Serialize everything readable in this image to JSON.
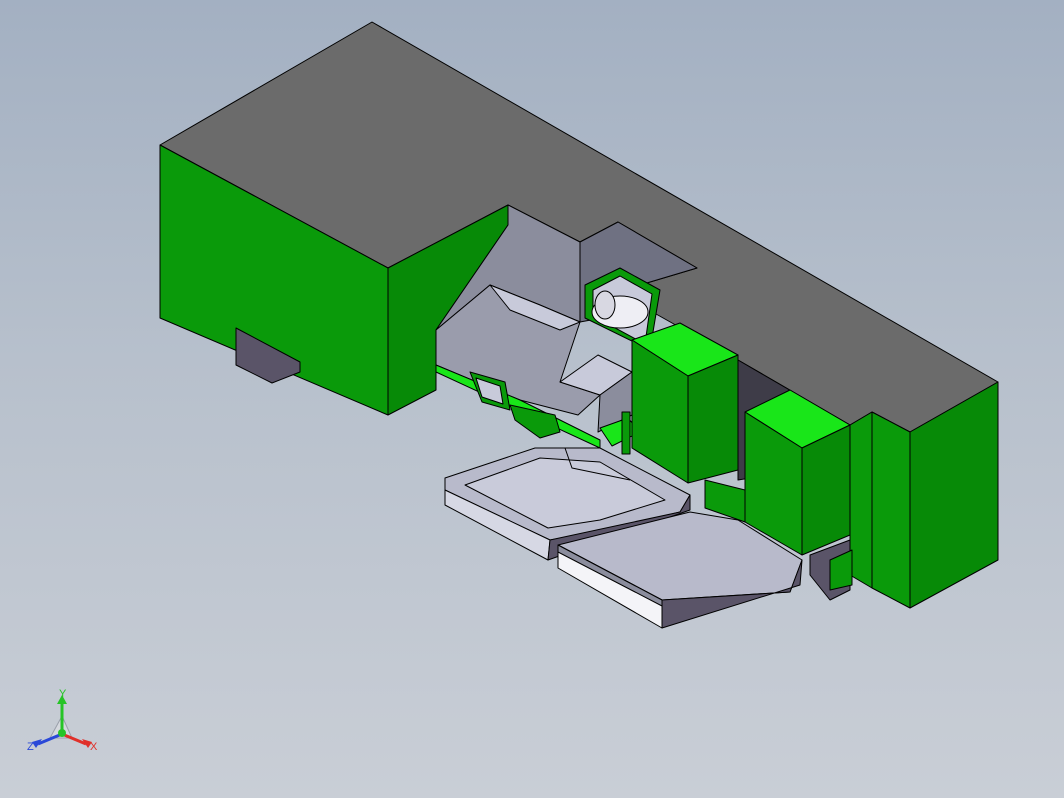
{
  "colors": {
    "background_top": "#a3b0c2",
    "background_bottom": "#c9ced6",
    "top_face": "#6b6b6b",
    "green_face": "#0a9a0a",
    "green_dark": "#078a07",
    "bright_green": "#19e619",
    "grey_face": "#8b8d9d",
    "light_grey": "#c8cada",
    "lavender_face": "#b8bacb",
    "dark_purple": "#5a5468",
    "axis_x": "#e0302a",
    "axis_y": "#26c426",
    "axis_z": "#2a48d8"
  },
  "triad": {
    "x_label": "X",
    "y_label": "Y",
    "z_label": "Z"
  },
  "icons": {
    "triad": "coordinate-axes-icon"
  }
}
